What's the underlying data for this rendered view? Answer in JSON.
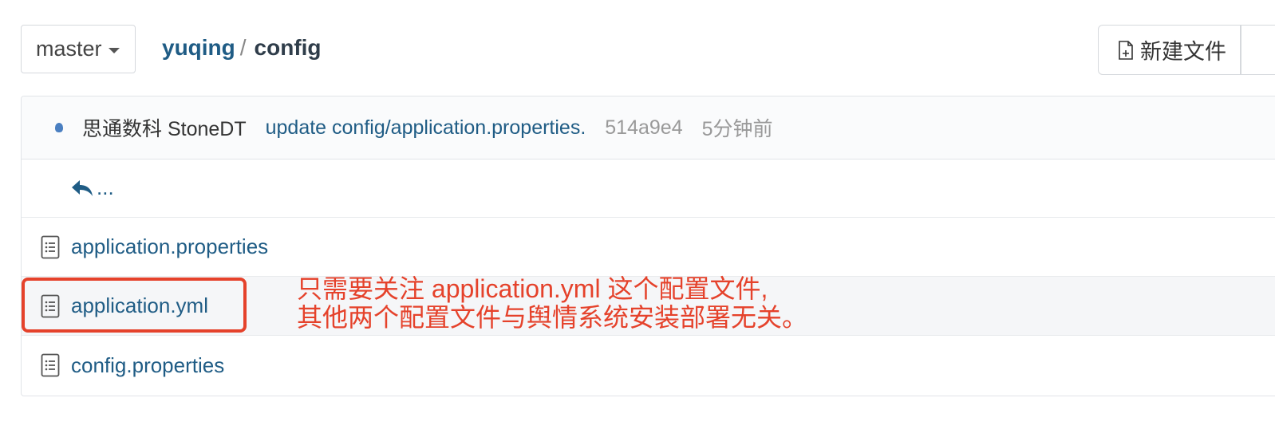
{
  "branch": {
    "label": "master"
  },
  "breadcrumb": {
    "repo": "yuqing",
    "separator": "/",
    "current": "config"
  },
  "toolbar": {
    "new_file_label": "新建文件"
  },
  "commit": {
    "author": "思通数科 StoneDT",
    "message": "update config/application.properties.",
    "hash": "514a9e4",
    "time": "5分钟前"
  },
  "parent_link": {
    "label": "..."
  },
  "files": [
    {
      "name": "application.properties"
    },
    {
      "name": "application.yml"
    },
    {
      "name": "config.properties"
    }
  ],
  "annotation": {
    "line1": "只需要关注 application.yml 这个配置文件,",
    "line2": "其他两个配置文件与舆情系统安装部署无关。"
  },
  "colors": {
    "link": "#1f5c85",
    "annotation": "#e5422b",
    "highlight_row": "#f5f6f8"
  }
}
